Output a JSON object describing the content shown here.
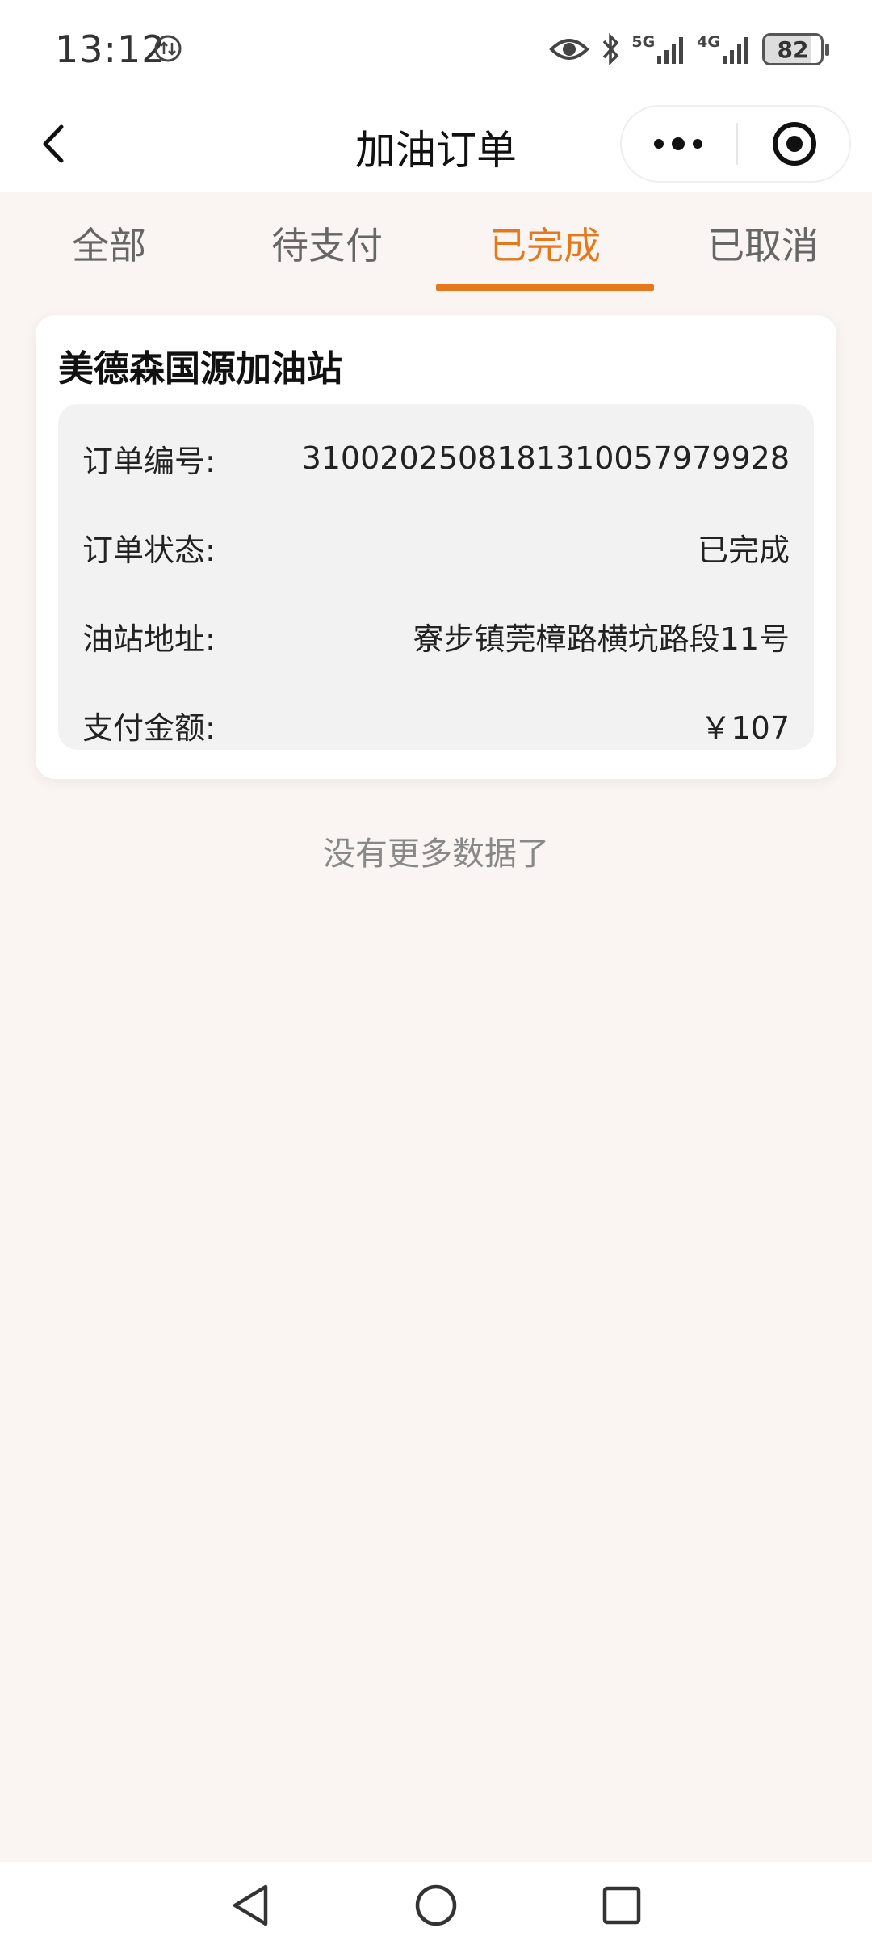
{
  "status_bar": {
    "time": "13:12",
    "network_1": "5G",
    "network_2": "4G",
    "battery": "82"
  },
  "nav": {
    "title": "加油订单"
  },
  "tabs": [
    {
      "label": "全部",
      "active": false
    },
    {
      "label": "待支付",
      "active": false
    },
    {
      "label": "已完成",
      "active": true
    },
    {
      "label": "已取消",
      "active": false
    }
  ],
  "order": {
    "station_name": "美德森国源加油站",
    "rows": [
      {
        "label": "订单编号:",
        "value": "310020250818131005797992‌8"
      },
      {
        "label": "订单状态:",
        "value": "已完成"
      },
      {
        "label": "油站地址:",
        "value": "寮步镇莞樟路横坑路段11号"
      },
      {
        "label": "支付金额:",
        "value": "￥107"
      }
    ]
  },
  "footer": {
    "no_more": "没有更多数据了"
  },
  "colors": {
    "accent": "#e4781b",
    "background": "#faf5f2"
  }
}
